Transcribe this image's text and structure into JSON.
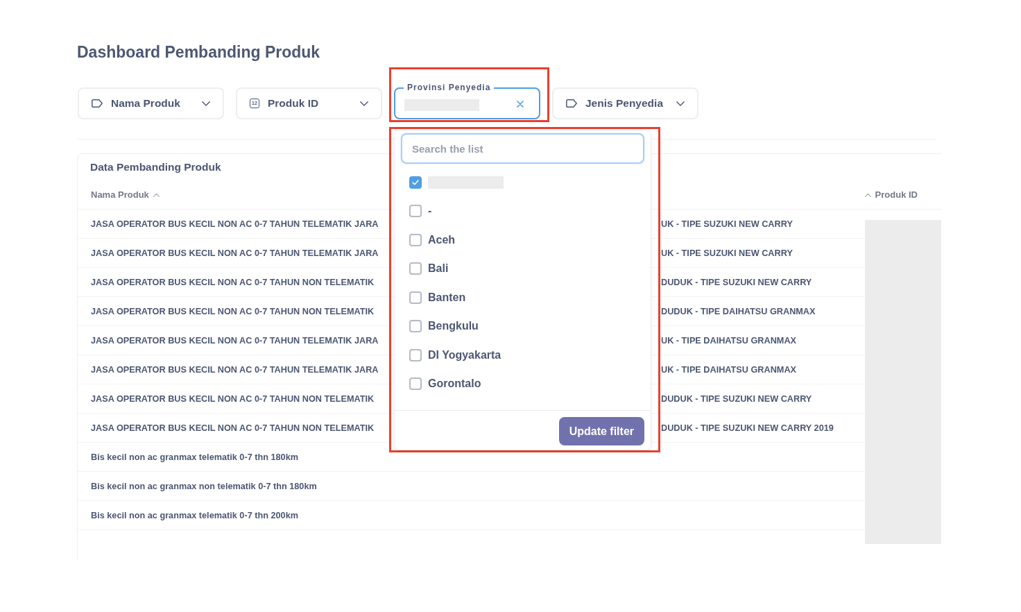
{
  "title": "Dashboard Pembanding Produk",
  "filters": [
    {
      "kind": "text",
      "label": "Nama Produk",
      "active": false,
      "highlighted": false
    },
    {
      "kind": "number",
      "label": "Produk ID",
      "icon_text": "12",
      "active": false,
      "highlighted": false
    },
    {
      "label": "Provinsi Penyedia",
      "active": true,
      "value_redacted": true,
      "highlighted": true,
      "dropdown": {
        "highlighted": true,
        "search": {
          "placeholder": "Search the list"
        },
        "options": [
          {
            "redacted": true,
            "checked": true
          },
          {
            "label": "-",
            "redacted": false,
            "checked": false
          },
          {
            "label": "Aceh",
            "redacted": false,
            "checked": false
          },
          {
            "label": "Bali",
            "redacted": false,
            "checked": false
          },
          {
            "label": "Banten",
            "redacted": false,
            "checked": false
          },
          {
            "label": "Bengkulu",
            "redacted": false,
            "checked": false
          },
          {
            "label": "DI Yogyakarta",
            "redacted": false,
            "checked": false
          },
          {
            "label": "Gorontalo",
            "redacted": false,
            "checked": false
          }
        ],
        "button": "Update filter"
      }
    },
    {
      "kind": "text",
      "label": "Jenis Penyedia",
      "active": false,
      "highlighted": false
    }
  ],
  "table": {
    "title": "Data Pembanding Produk",
    "columns": [
      {
        "label": "Nama Produk",
        "sorted": true
      },
      {
        "label": "Produk ID",
        "sorted": true
      }
    ],
    "id_column_redacted": true,
    "rows": [
      {
        "name_start": "JASA OPERATOR BUS KECIL NON AC 0-7 TAHUN TELEMATIK JARA",
        "name_end": "UK - TIPE SUZUKI NEW CARRY"
      },
      {
        "name_start": "JASA OPERATOR BUS KECIL NON AC 0-7 TAHUN TELEMATIK JARA",
        "name_end": "UK - TIPE SUZUKI NEW CARRY"
      },
      {
        "name_start": "JASA OPERATOR BUS KECIL NON AC 0-7 TAHUN NON TELEMATIK",
        "name_end": "DUDUK - TIPE SUZUKI NEW CARRY"
      },
      {
        "name_start": "JASA OPERATOR BUS KECIL NON AC 0-7 TAHUN NON TELEMATIK",
        "name_end": "DUDUK - TIPE DAIHATSU GRANMAX"
      },
      {
        "name_start": "JASA OPERATOR BUS KECIL NON AC 0-7 TAHUN TELEMATIK JARA",
        "name_end": "UK - TIPE DAIHATSU GRANMAX"
      },
      {
        "name_start": "JASA OPERATOR BUS KECIL NON AC 0-7 TAHUN TELEMATIK JARA",
        "name_end": "UK - TIPE DAIHATSU GRANMAX"
      },
      {
        "name_start": "JASA OPERATOR BUS KECIL NON AC 0-7 TAHUN NON TELEMATIK",
        "name_end": "DUDUK - TIPE SUZUKI NEW CARRY"
      },
      {
        "name_start": "JASA OPERATOR BUS KECIL NON AC 0-7 TAHUN NON TELEMATIK",
        "name_end": "DUDUK - TIPE SUZUKI NEW CARRY 2019"
      },
      {
        "name_start": "Bis kecil non ac granmax telematik 0-7 thn 180km"
      },
      {
        "name_start": "Bis kecil non ac granmax non telematik 0-7 thn 180km"
      },
      {
        "name_start": "Bis kecil non ac granmax telematik 0-7 thn 200km"
      }
    ]
  }
}
